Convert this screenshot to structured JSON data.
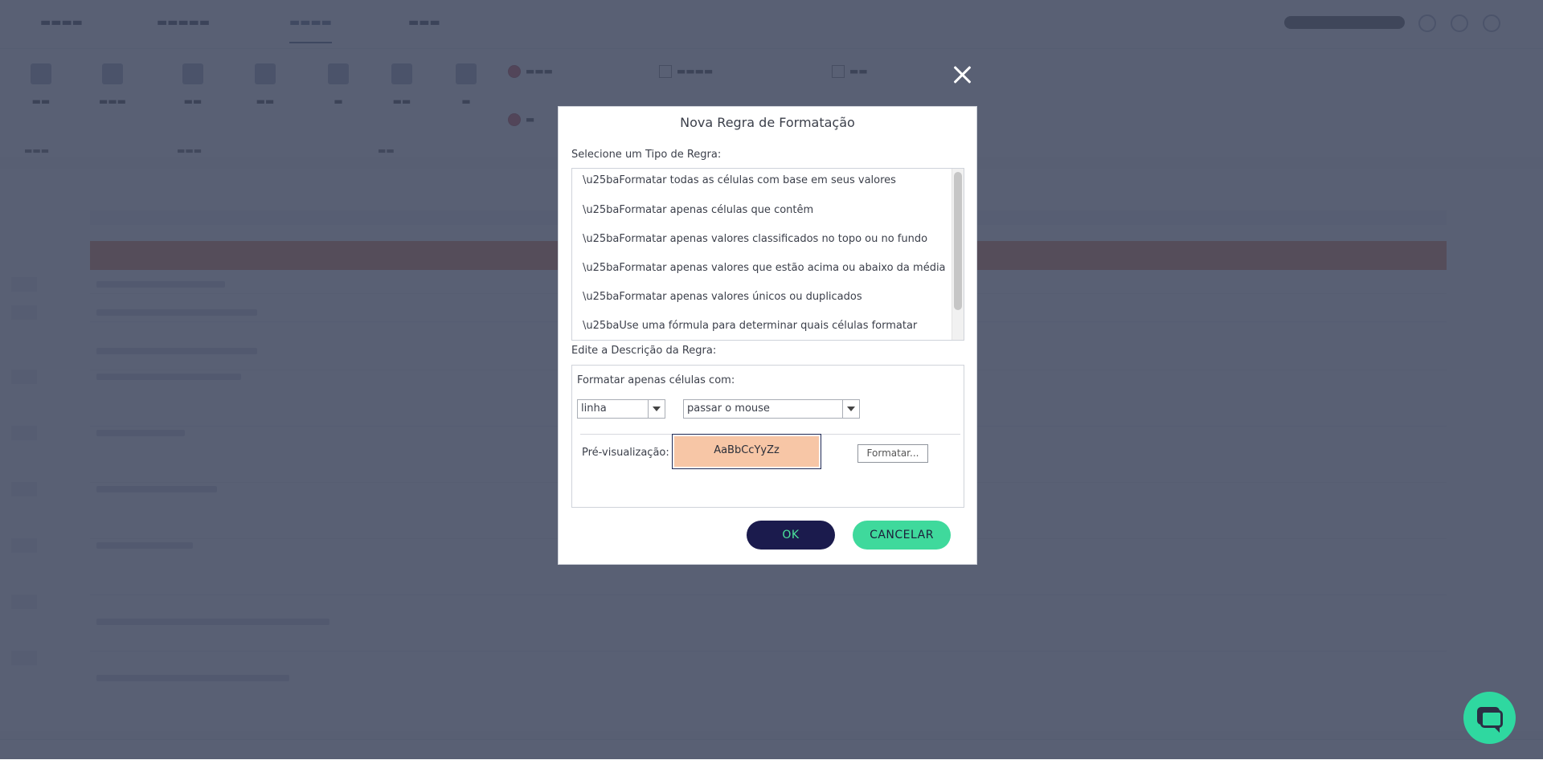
{
  "modal": {
    "title": "Nova Regra de Formatação",
    "select_type_label": "Selecione um Tipo de Regra:",
    "rule_types": [
      "\\u25baFormatar todas as células com base em seus valores",
      "\\u25baFormatar apenas células que contêm",
      "\\u25baFormatar apenas valores classificados no topo ou no fundo",
      "\\u25baFormatar apenas valores que estão acima ou abaixo da média",
      "\\u25baFormatar apenas valores únicos ou duplicados",
      "\\u25baUse uma fórmula para determinar quais células formatar"
    ],
    "edit_desc_label": "Edite a Descrição da Regra:",
    "format_only_label": "Formatar apenas células com:",
    "select1_value": "linha",
    "select2_value": "passar o mouse",
    "preview_label": "Pré-visualização:",
    "preview_text": "AaBbCcYyZz",
    "format_button": "Formatar...",
    "ok_button": "OK",
    "cancel_button": "CANCELAR"
  },
  "colors": {
    "overlay": "#3e465d",
    "preview_fill": "#f7c6a6",
    "ok_bg": "#1b1b4d",
    "ok_text": "#4be39a",
    "cancel_bg": "#3fd99c",
    "chat_fab": "#2fd8a0"
  },
  "icons": {
    "close": "close-icon",
    "chat": "chat-icon"
  }
}
